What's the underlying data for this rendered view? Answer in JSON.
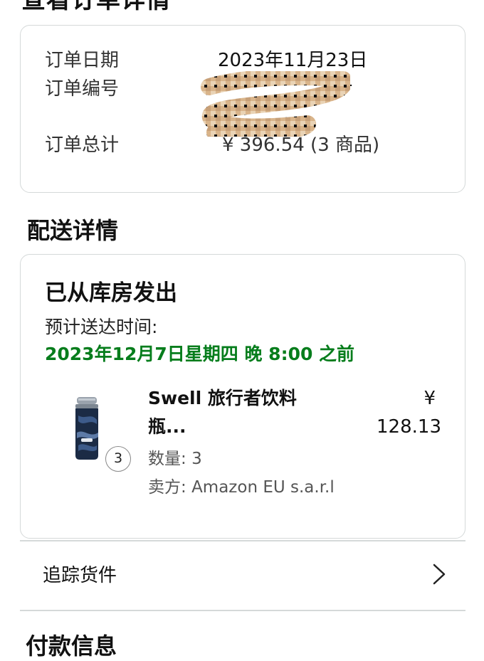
{
  "header": {
    "page_title": "查看订单详情"
  },
  "order_summary": {
    "date_label": "订单日期",
    "date_value": "2023年11月23日",
    "number_label": "订单编号",
    "number_value_visible_fragment": "-",
    "total_label": "订单总计",
    "total_value": "¥ 396.54 (3 商品)"
  },
  "shipping": {
    "section_title": "配送详情",
    "status": "已从库房发出",
    "eta_label": "预计送达时间:",
    "eta_value": "2023年12月7日星期四 晚 8:00 之前",
    "item": {
      "title_line1": "Swell 旅行者饮料",
      "title_line2": "瓶...",
      "price_currency": "¥",
      "price_amount": "128.13",
      "quantity_badge": "3",
      "quantity_label": "数量:",
      "quantity_value": "3",
      "seller_label": "卖方:",
      "seller_value": "Amazon EU s.a.r.l",
      "icon": "water-bottle-image"
    },
    "track_label": "追踪货件"
  },
  "payment": {
    "section_title": "付款信息"
  },
  "colors": {
    "eta_green": "#067d1c",
    "border": "#d5d9d9",
    "text": "#111111"
  }
}
